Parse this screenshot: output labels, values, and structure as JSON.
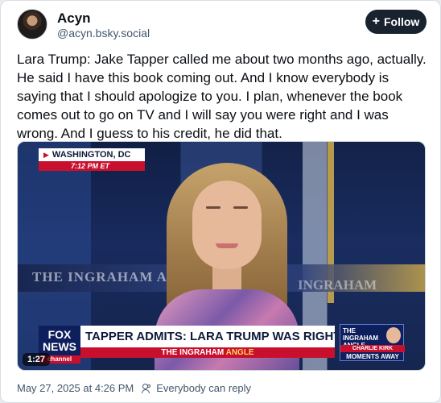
{
  "post": {
    "author_name": "Acyn",
    "author_handle": "@acyn.bsky.social",
    "follow_label": "Follow",
    "text": "Lara Trump: Jake Tapper called me about two months ago, actually. He said I have this book coming out. And I know everybody is saying that I should apologize to you. I plan, whenever the book comes out to go on TV and I will say you were right and I was wrong. And I guess to his credit, he did that.",
    "timestamp": "May 27, 2025 at 4:26 PM",
    "reply_setting": "Everybody can reply"
  },
  "video": {
    "duration": "1:27",
    "location": "WASHINGTON, DC",
    "time": "7:12 PM ET",
    "logo_line1": "FOX",
    "logo_line2": "NEWS",
    "logo_channel": "channel",
    "headline": "TAPPER ADMITS: LARA TRUMP WAS RIGHT, I WAS WRONG",
    "show_prefix": "THE INGRAHAM",
    "show_suffix": "ANGLE",
    "wall_text_left": "THE INGRAHAM ANGLE",
    "wall_text_right": "INGRAHAM",
    "promo_show_line1": "THE",
    "promo_show_line2": "INGRAHAM",
    "promo_show_line3": "ANGLE",
    "promo_name": "CHARLIE KIRK",
    "promo_sub": "MOMENTS AWAY"
  },
  "colors": {
    "follow_bg": "#18232f",
    "fox_red": "#c8102e",
    "fox_navy": "#0d1f5c",
    "meta_text": "#42576c"
  },
  "icons": {
    "plus": "plus-icon",
    "reply_audience": "people-icon"
  }
}
